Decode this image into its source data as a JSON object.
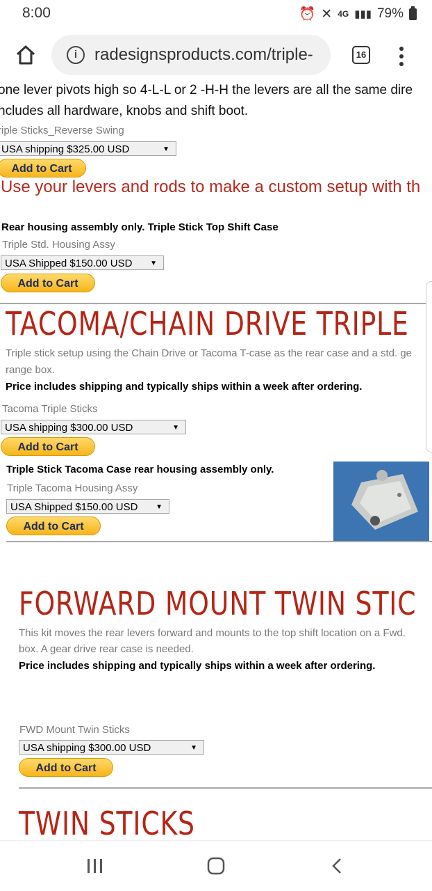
{
  "status": {
    "time": "8:00",
    "battery": "79%"
  },
  "browser": {
    "url": "radesignsproducts.com/triple-",
    "tab_count": "16"
  },
  "top": {
    "line1": "one lever pivots high so 4-L-L or 2 -H-H the levers are all the same dire",
    "line2": "ncludes all hardware, knobs and shift boot.",
    "product_name": "riple Sticks_Reverse Swing",
    "select_value": "USA shipping $325.00 USD",
    "promo": "Use your levers and rods to make a custom setup with th"
  },
  "add_to_cart_label": "Add to Cart",
  "rear_housing": {
    "title": "Rear housing assembly only. Triple Stick Top Shift Case",
    "product_name": "Triple Std. Housing Assy",
    "select_value": "USA Shipped $150.00 USD"
  },
  "tacoma": {
    "heading": "TACOMA/CHAIN DRIVE TRIPLE",
    "desc1": "Triple stick setup using the Chain Drive or Tacoma T-case as the rear case and a std. ge",
    "desc2": "range box.",
    "price_note": "Price includes shipping and typically ships within a week after ordering.",
    "product_name": "Tacoma Triple Sticks",
    "select_value": "USA shipping $300.00 USD",
    "housing_title": "Triple Stick Tacoma Case rear housing assembly only.",
    "housing_product": "Triple Tacoma Housing Assy",
    "housing_select": "USA Shipped $150.00 USD"
  },
  "forward": {
    "heading": "FORWARD MOUNT TWIN STIC",
    "desc1": "This kit moves the rear levers forward and mounts to the top shift location on a Fwd.",
    "desc2": "box. A gear drive rear case is needed.",
    "price_note": "Price includes shipping and typically ships within a week after ordering.",
    "product_name": "FWD Mount Twin Sticks",
    "select_value": "USA shipping $300.00 USD"
  },
  "twin": {
    "heading": "TWIN STICKS"
  },
  "colors": {
    "heading_red": "#b52516",
    "promo_red": "#b6291e",
    "cart_yellow": "#f7b51a"
  }
}
